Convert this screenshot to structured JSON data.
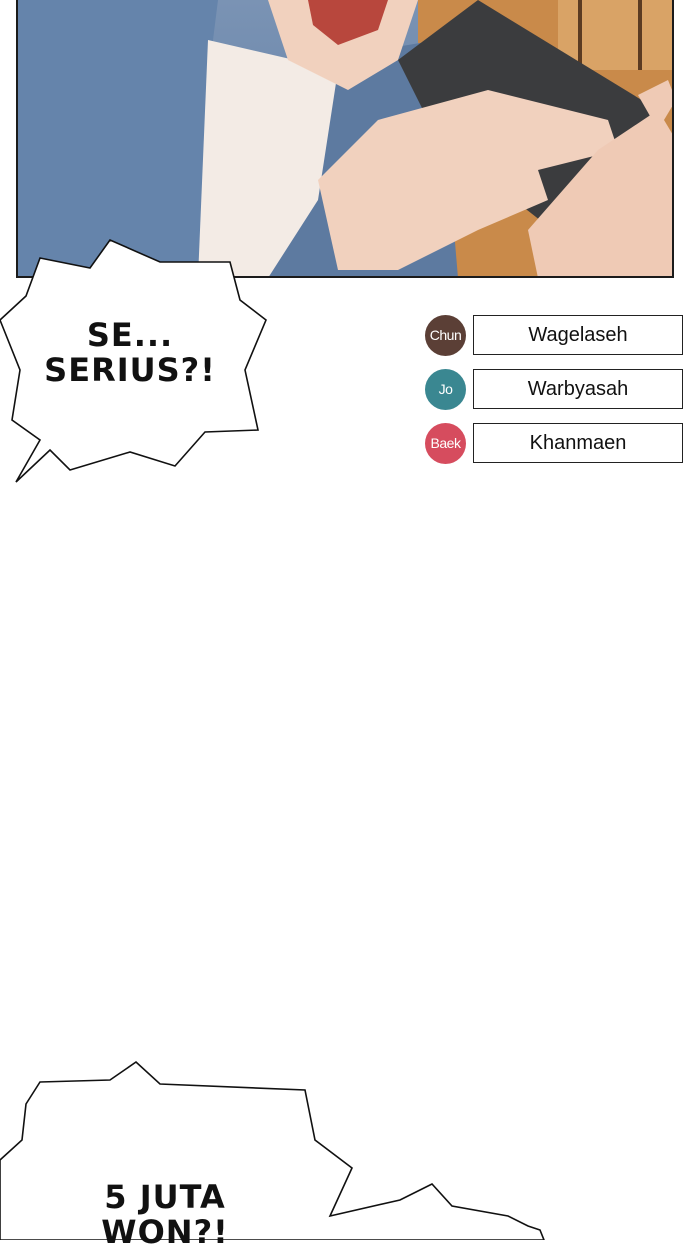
{
  "panel": {
    "jacket_color": "#6584ab",
    "shirt_color": "#f3ebe5",
    "skin_color": "#f1d1be",
    "phone_color": "#3b3c3e",
    "background_color": "#c98a4a"
  },
  "bubbles": [
    {
      "text": "SE...\nSERIUS?!"
    },
    {
      "text": "5 JUTA\nWON?!"
    }
  ],
  "credits": [
    {
      "badge": "Chun",
      "badge_color": "#5b3f36",
      "name": "Wagelaseh"
    },
    {
      "badge": "Jo",
      "badge_color": "#3a8791",
      "name": "Warbyasah"
    },
    {
      "badge": "Baek",
      "badge_color": "#d64c5e",
      "name": "Khanmaen"
    }
  ]
}
